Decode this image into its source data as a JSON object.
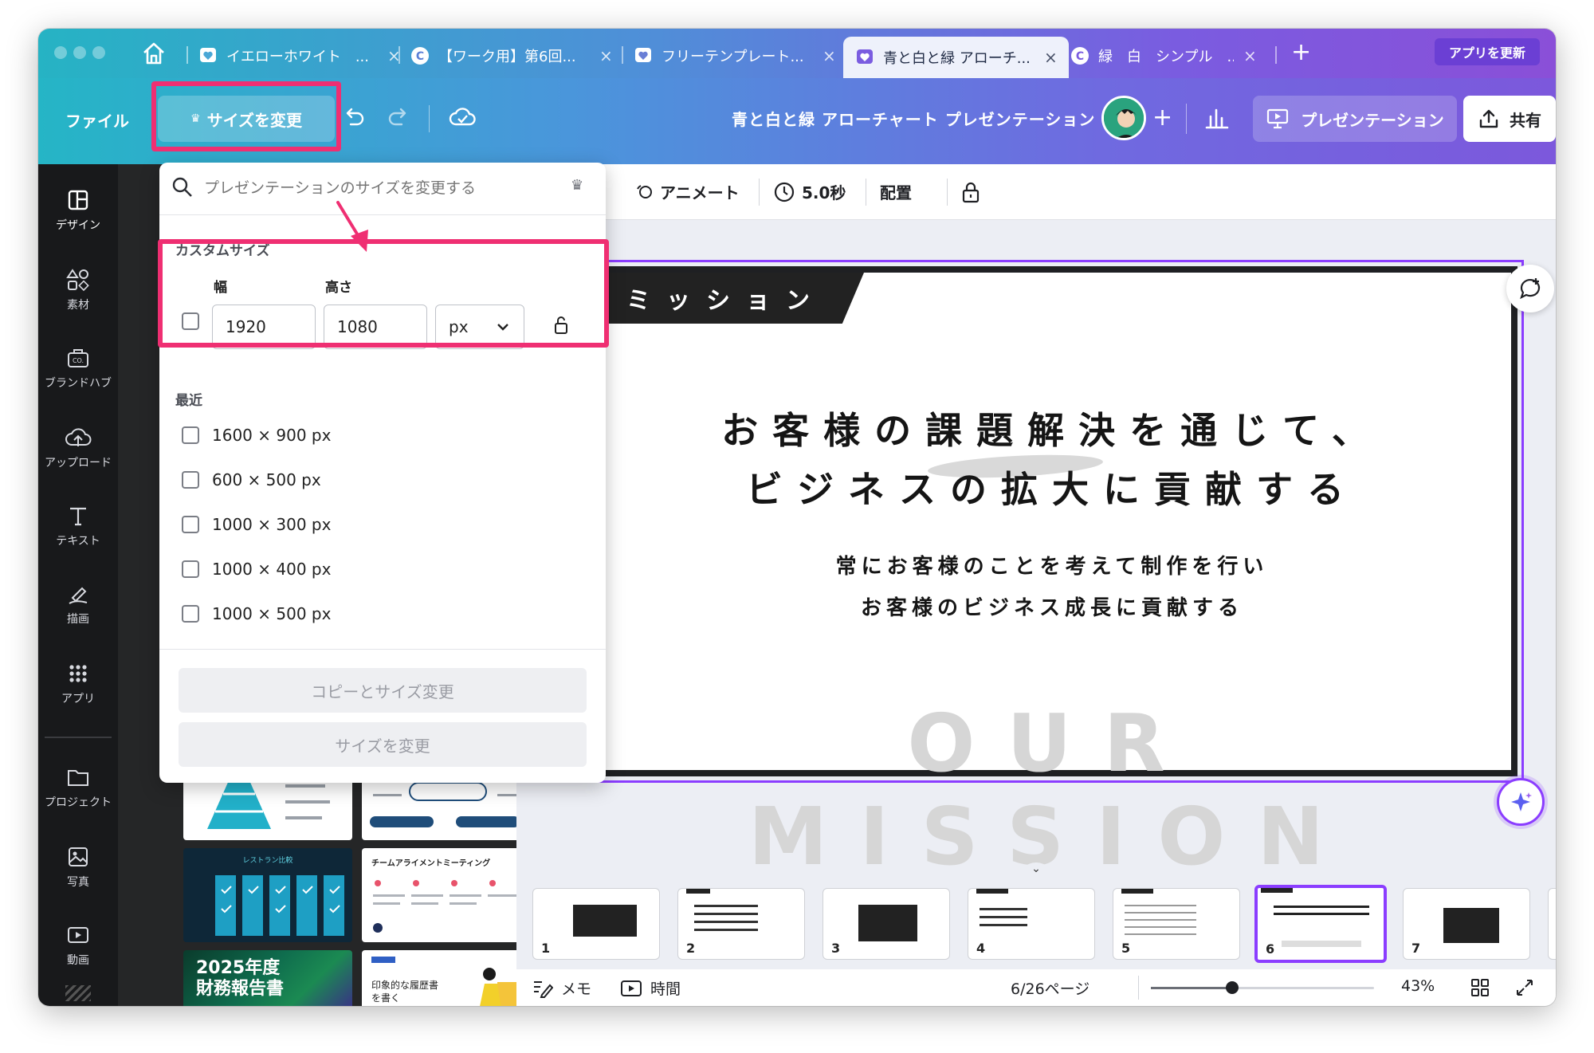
{
  "tabs": [
    {
      "label": "イエローホワイト　..."
    },
    {
      "label": "【ワーク用】第6回..."
    },
    {
      "label": "フリーテンプレート..."
    },
    {
      "label": "青と白と緑 アローチ..."
    },
    {
      "label": "緑　白　シンプル　..."
    }
  ],
  "tabbar": {
    "update_label": "アプリを更新"
  },
  "topbar": {
    "file_label": "ファイル",
    "resize_label": "サイズを変更",
    "doc_title": "青と白と緑 アローチャート プレゼンテーション",
    "present_label": "プレゼンテーション",
    "share_label": "共有"
  },
  "sidebar": {
    "items": [
      {
        "label": "デザイン"
      },
      {
        "label": "素材"
      },
      {
        "label": "ブランドハブ"
      },
      {
        "label": "アップロード"
      },
      {
        "label": "テキスト"
      },
      {
        "label": "描画"
      },
      {
        "label": "アプリ"
      },
      {
        "label": "プロジェクト"
      },
      {
        "label": "写真"
      },
      {
        "label": "動画"
      }
    ]
  },
  "panel": {
    "templates": [
      {
        "title": ""
      },
      {
        "title": ""
      },
      {
        "title": "レストラン比較"
      },
      {
        "title": "チームアライメントミーティング"
      },
      {
        "title": "2025年度\n財務報告書"
      },
      {
        "title": "印象的な履歴書\nを書く"
      }
    ]
  },
  "toolbar2": {
    "animate_label": "アニメート",
    "duration_label": "5.0秒",
    "arrange_label": "配置"
  },
  "slide": {
    "tag": "ミッション",
    "heading_line1": "お客様の課題解決を通じて、",
    "heading_line2": "ビジネスの拡大に貢献する",
    "sub_line1": "常にお客様のことを考えて制作を行い",
    "sub_line2": "お客様のビジネス成長に貢献する",
    "bg_text": "OUR MISSION"
  },
  "filmstrip": {
    "pages": [
      "1",
      "2",
      "3",
      "4",
      "5",
      "6",
      "7"
    ],
    "selected": "6"
  },
  "footer": {
    "notes_label": "メモ",
    "time_label": "時間",
    "page_indicator": "6/26ページ",
    "zoom": "43%"
  },
  "dropdown": {
    "search_placeholder": "プレゼンテーションのサイズを変更する",
    "custom_size_label": "カスタムサイズ",
    "width_label": "幅",
    "height_label": "高さ",
    "width_value": "1920",
    "height_value": "1080",
    "unit_value": "px",
    "recent_label": "最近",
    "recent": [
      "1600 × 900 px",
      "600 × 500 px",
      "1000 × 300 px",
      "1000 × 400 px",
      "1000 × 500 px"
    ],
    "copy_resize_label": "コピーとサイズ変更",
    "resize_label": "サイズを変更"
  },
  "colors": {
    "highlight": "#ef2f72",
    "accent": "#8b3dff",
    "tab_gradient_start": "#26b3c4",
    "tab_gradient_end": "#8a4fd8"
  }
}
